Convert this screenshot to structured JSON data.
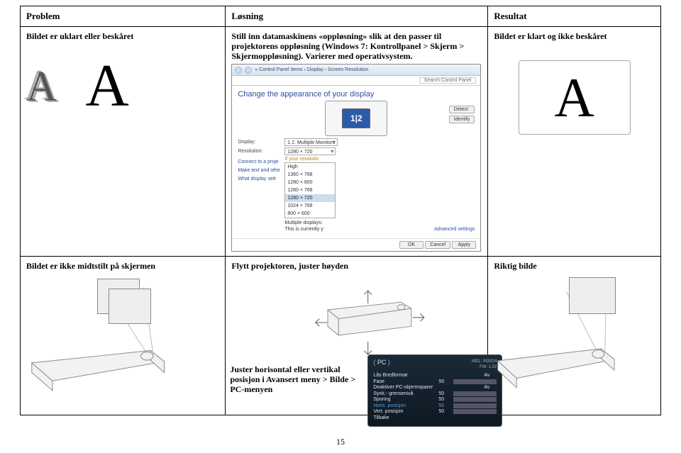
{
  "headers": {
    "col1": "Problem",
    "col2": "Løsning",
    "col3": "Resultat"
  },
  "row1": {
    "problem": "Bildet er uklart eller beskåret",
    "solution": "Still inn datamaskinens «oppløsning» slik at den passer til projektorens oppløsning (Windows 7: Kontrollpanel > Skjerm > Skjermoppløsning). Varierer med operativsystem.",
    "result": "Bildet er klart og ikke beskåret",
    "letterA": "A"
  },
  "win": {
    "path": "« Control Panel Items › Display › Screen Resolution",
    "searchTab": "Search Control Panel",
    "title": "Change the appearance of your display",
    "btnDetect": "Detect",
    "btnIdentify": "Identify",
    "lblDisplay": "Display:",
    "valDisplay": "1 2. Multiple Monitors",
    "lblResolution": "Resolution:",
    "valResolution": "1280 × 720",
    "hint": "If your resolutio",
    "lblMultiple": "Multiple displays:",
    "lblCurrently": "This is currently y",
    "linkAdvanced": "Advanced settings",
    "sideConnect": "Connect to a proje",
    "sideText": "Make text and othe",
    "sideWhat": "What display sett",
    "btnOK": "OK",
    "btnCancel": "Cancel",
    "btnApply": "Apply",
    "resolutions": [
      "High",
      "1360 × 768",
      "1280 × 800",
      "1280 × 768",
      "1280 × 720",
      "1024 × 768",
      "800 × 600"
    ]
  },
  "row2": {
    "problem": "Bildet er ikke midtstilt på skjermen",
    "solution": "Flytt projektoren, juster høyden",
    "result": "Riktig bilde",
    "adjust": "Juster horisontal eller vertikal posisjon i Avansert meny > Bilde > PC-menyen"
  },
  "osd": {
    "pcLabel": "PC",
    "model": "MDL: IN3924",
    "fw": "FW: 1.02",
    "items": [
      {
        "l": "Lås Bredformat",
        "v": "Av"
      },
      {
        "l": "Fase",
        "v": "50",
        "bar": 50
      },
      {
        "l": "Deaktiver PC-skjermsparer",
        "v": "Av"
      },
      {
        "l": "Synk.- grensenivå",
        "v": "50",
        "bar": 50
      },
      {
        "l": "Sporing",
        "v": "50",
        "bar": 50
      },
      {
        "l": "Horis. posisjon",
        "v": "50",
        "bar": 50,
        "hi": true
      },
      {
        "l": "Vert. posisjon",
        "v": "50",
        "bar": 50
      }
    ],
    "back": "Tilbake"
  },
  "pageNumber": "15"
}
